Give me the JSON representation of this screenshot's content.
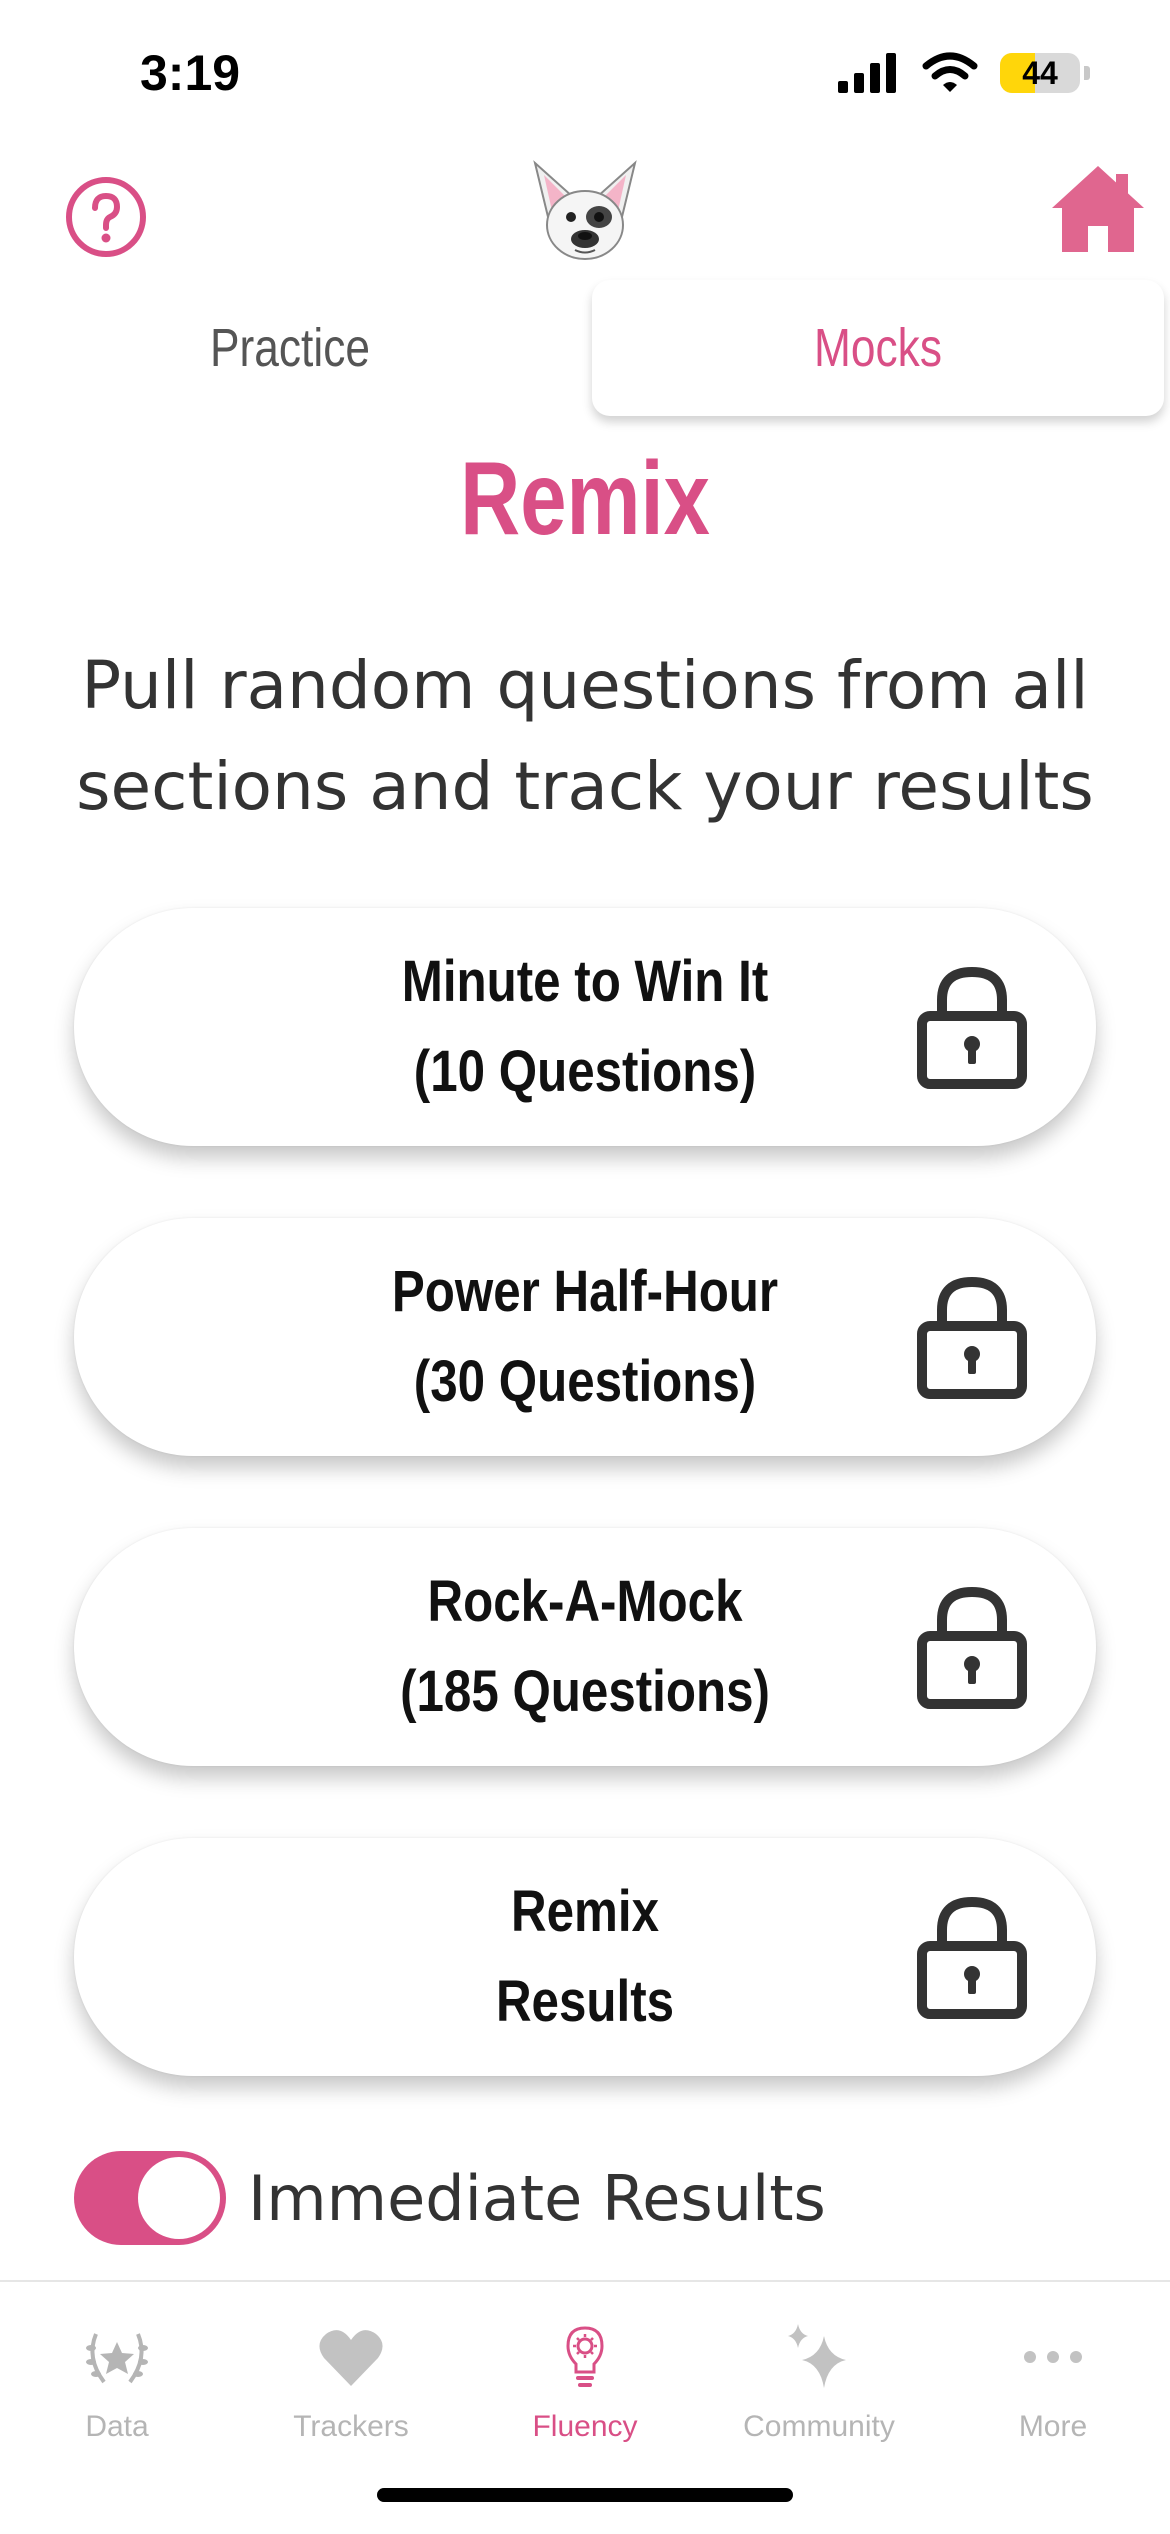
{
  "status_bar": {
    "time": "3:19",
    "battery": "44",
    "battery_level": 0.44
  },
  "header": {
    "help_icon": "help-circle-icon",
    "logo": "french-bulldog-logo",
    "home_icon": "home-icon"
  },
  "tabs": [
    {
      "label": "Practice",
      "active": false
    },
    {
      "label": "Mocks",
      "active": true
    }
  ],
  "main": {
    "title": "Remix",
    "subtitle": "Pull random questions from all sections and track your results",
    "options": [
      {
        "line1": "Minute to Win It",
        "line2": "(10 Questions)",
        "icon": "lock-icon"
      },
      {
        "line1": "Power Half-Hour",
        "line2": "(30 Questions)",
        "icon": "lock-icon"
      },
      {
        "line1": "Rock-A-Mock",
        "line2": "(185 Questions)",
        "icon": "lock-icon"
      },
      {
        "line1": "Remix",
        "line2": "Results",
        "icon": "lock-icon"
      }
    ],
    "toggle": {
      "label": "Immediate Results",
      "on": true
    }
  },
  "tabbar": [
    {
      "label": "Data",
      "icon": "laurel-star-icon",
      "active": false
    },
    {
      "label": "Trackers",
      "icon": "heart-icon",
      "active": false
    },
    {
      "label": "Fluency",
      "icon": "lightbulb-icon",
      "active": true
    },
    {
      "label": "Community",
      "icon": "sparkles-icon",
      "active": false
    },
    {
      "label": "More",
      "icon": "ellipsis-icon",
      "active": false
    }
  ],
  "colors": {
    "accent": "#d94f86",
    "text": "#333333",
    "inactive": "#b5b5b5"
  }
}
